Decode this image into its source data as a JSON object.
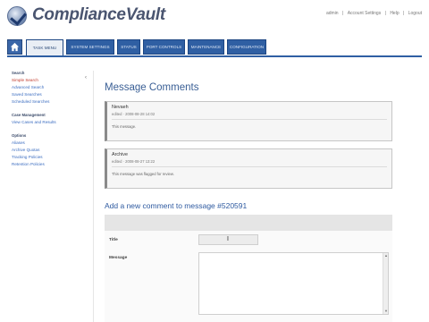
{
  "header": {
    "logo_text": "ComplianceVault",
    "user_links": [
      "admin",
      "|",
      "Account Settings",
      "|",
      "Help",
      "|",
      "Logout"
    ]
  },
  "tabs": [
    {
      "label": "TASK MENU",
      "active": true
    },
    {
      "label": "SYSTEM SETTINGS",
      "active": false
    },
    {
      "label": "STATUS",
      "active": false
    },
    {
      "label": "PORT CONTROLS",
      "active": false
    },
    {
      "label": "MAINTENANCE",
      "active": false
    },
    {
      "label": "CONFIGURATION",
      "active": false
    }
  ],
  "sidebar": {
    "sections": [
      {
        "heading": "Search",
        "items": [
          {
            "label": "Simple Search",
            "current": true
          },
          {
            "label": "Advanced Search",
            "current": false
          },
          {
            "label": "Saved Searches",
            "current": false
          },
          {
            "label": "Scheduled Searches",
            "current": false
          }
        ]
      },
      {
        "heading": "Case Management",
        "items": [
          {
            "label": "View Cases and Results",
            "current": false
          }
        ]
      },
      {
        "heading": "Options",
        "items": [
          {
            "label": "Aliases",
            "current": false
          },
          {
            "label": "Archive Quotas",
            "current": false
          },
          {
            "label": "Tracking Policies",
            "current": false
          },
          {
            "label": "Retention Policies",
            "current": false
          }
        ]
      }
    ],
    "collapse_arrow": "‹"
  },
  "main": {
    "title": "Message Comments",
    "comments": [
      {
        "name": "Nevaeh",
        "meta": "edited · 2008-08-28 14:02",
        "text": "This message."
      },
      {
        "name": "Archive",
        "meta": "edited · 2008-08-27 13:22",
        "text": "This message was flagged for review."
      }
    ],
    "form": {
      "title": "Add a new comment to message #520591",
      "title_label": "Title",
      "title_value": "",
      "message_label": "Message",
      "message_value": "",
      "cursor_glyph": "I"
    }
  },
  "colors": {
    "tab_blue": "#2f5fa3",
    "heading_blue": "#3a5f95",
    "link_blue": "#3a6cc0",
    "active_link_red": "#c0392b"
  }
}
